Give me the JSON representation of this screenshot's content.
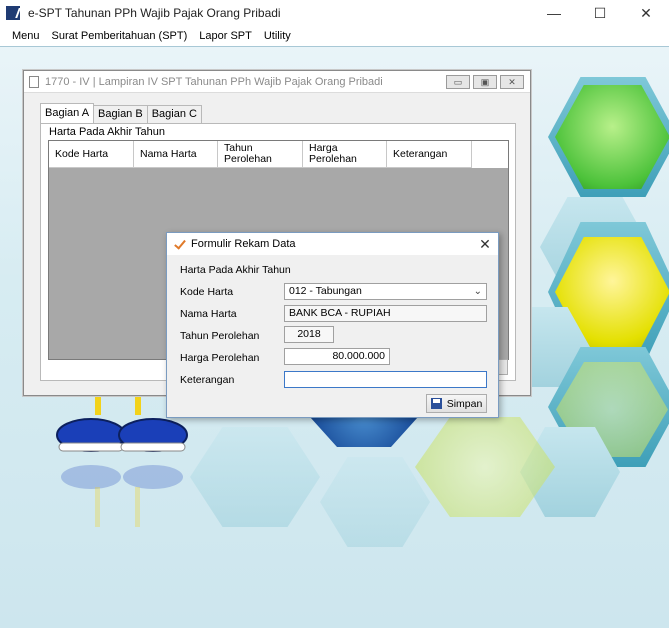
{
  "app": {
    "title": "e-SPT Tahunan PPh Wajib Pajak Orang Pribadi"
  },
  "window_controls": {
    "minimize": "—",
    "maximize": "☐",
    "close": "✕"
  },
  "menu": [
    "Menu",
    "Surat Pemberitahuan (SPT)",
    "Lapor SPT",
    "Utility"
  ],
  "child_window": {
    "title": "1770 - IV | Lampiran IV SPT Tahunan PPh Wajib Pajak Orang Pribadi",
    "tabs": [
      "Bagian A",
      "Bagian B",
      "Bagian C"
    ],
    "active_tab": "Bagian A",
    "group_label": "Harta Pada Akhir Tahun",
    "grid_headers": [
      "Kode Harta",
      "Nama Harta",
      "Tahun\nPerolehan",
      "Harga\nPerolehan",
      "Keterangan"
    ]
  },
  "dialog": {
    "title": "Formulir Rekam Data",
    "section_label": "Harta Pada Akhir Tahun",
    "kode_harta_label": "Kode Harta",
    "kode_harta_value": "012 - Tabungan",
    "nama_harta_label": "Nama Harta",
    "nama_harta_value": "BANK BCA - RUPIAH",
    "tahun_label": "Tahun Perolehan",
    "tahun_value": "2018",
    "harga_label": "Harga Perolehan",
    "harga_value": "80.000.000",
    "keterangan_label": "Keterangan",
    "keterangan_value": "",
    "save_label": "Simpan",
    "close": "✕"
  }
}
